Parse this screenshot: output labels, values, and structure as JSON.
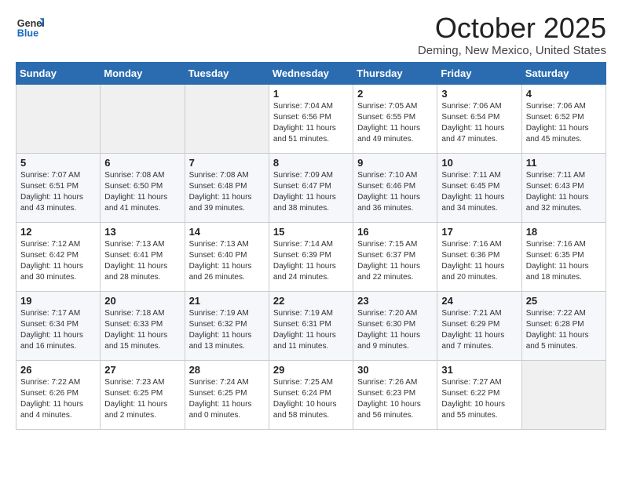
{
  "logo": {
    "general": "General",
    "blue": "Blue"
  },
  "header": {
    "month": "October 2025",
    "location": "Deming, New Mexico, United States"
  },
  "weekdays": [
    "Sunday",
    "Monday",
    "Tuesday",
    "Wednesday",
    "Thursday",
    "Friday",
    "Saturday"
  ],
  "weeks": [
    [
      {
        "day": "",
        "info": ""
      },
      {
        "day": "",
        "info": ""
      },
      {
        "day": "",
        "info": ""
      },
      {
        "day": "1",
        "info": "Sunrise: 7:04 AM\nSunset: 6:56 PM\nDaylight: 11 hours\nand 51 minutes."
      },
      {
        "day": "2",
        "info": "Sunrise: 7:05 AM\nSunset: 6:55 PM\nDaylight: 11 hours\nand 49 minutes."
      },
      {
        "day": "3",
        "info": "Sunrise: 7:06 AM\nSunset: 6:54 PM\nDaylight: 11 hours\nand 47 minutes."
      },
      {
        "day": "4",
        "info": "Sunrise: 7:06 AM\nSunset: 6:52 PM\nDaylight: 11 hours\nand 45 minutes."
      }
    ],
    [
      {
        "day": "5",
        "info": "Sunrise: 7:07 AM\nSunset: 6:51 PM\nDaylight: 11 hours\nand 43 minutes."
      },
      {
        "day": "6",
        "info": "Sunrise: 7:08 AM\nSunset: 6:50 PM\nDaylight: 11 hours\nand 41 minutes."
      },
      {
        "day": "7",
        "info": "Sunrise: 7:08 AM\nSunset: 6:48 PM\nDaylight: 11 hours\nand 39 minutes."
      },
      {
        "day": "8",
        "info": "Sunrise: 7:09 AM\nSunset: 6:47 PM\nDaylight: 11 hours\nand 38 minutes."
      },
      {
        "day": "9",
        "info": "Sunrise: 7:10 AM\nSunset: 6:46 PM\nDaylight: 11 hours\nand 36 minutes."
      },
      {
        "day": "10",
        "info": "Sunrise: 7:11 AM\nSunset: 6:45 PM\nDaylight: 11 hours\nand 34 minutes."
      },
      {
        "day": "11",
        "info": "Sunrise: 7:11 AM\nSunset: 6:43 PM\nDaylight: 11 hours\nand 32 minutes."
      }
    ],
    [
      {
        "day": "12",
        "info": "Sunrise: 7:12 AM\nSunset: 6:42 PM\nDaylight: 11 hours\nand 30 minutes."
      },
      {
        "day": "13",
        "info": "Sunrise: 7:13 AM\nSunset: 6:41 PM\nDaylight: 11 hours\nand 28 minutes."
      },
      {
        "day": "14",
        "info": "Sunrise: 7:13 AM\nSunset: 6:40 PM\nDaylight: 11 hours\nand 26 minutes."
      },
      {
        "day": "15",
        "info": "Sunrise: 7:14 AM\nSunset: 6:39 PM\nDaylight: 11 hours\nand 24 minutes."
      },
      {
        "day": "16",
        "info": "Sunrise: 7:15 AM\nSunset: 6:37 PM\nDaylight: 11 hours\nand 22 minutes."
      },
      {
        "day": "17",
        "info": "Sunrise: 7:16 AM\nSunset: 6:36 PM\nDaylight: 11 hours\nand 20 minutes."
      },
      {
        "day": "18",
        "info": "Sunrise: 7:16 AM\nSunset: 6:35 PM\nDaylight: 11 hours\nand 18 minutes."
      }
    ],
    [
      {
        "day": "19",
        "info": "Sunrise: 7:17 AM\nSunset: 6:34 PM\nDaylight: 11 hours\nand 16 minutes."
      },
      {
        "day": "20",
        "info": "Sunrise: 7:18 AM\nSunset: 6:33 PM\nDaylight: 11 hours\nand 15 minutes."
      },
      {
        "day": "21",
        "info": "Sunrise: 7:19 AM\nSunset: 6:32 PM\nDaylight: 11 hours\nand 13 minutes."
      },
      {
        "day": "22",
        "info": "Sunrise: 7:19 AM\nSunset: 6:31 PM\nDaylight: 11 hours\nand 11 minutes."
      },
      {
        "day": "23",
        "info": "Sunrise: 7:20 AM\nSunset: 6:30 PM\nDaylight: 11 hours\nand 9 minutes."
      },
      {
        "day": "24",
        "info": "Sunrise: 7:21 AM\nSunset: 6:29 PM\nDaylight: 11 hours\nand 7 minutes."
      },
      {
        "day": "25",
        "info": "Sunrise: 7:22 AM\nSunset: 6:28 PM\nDaylight: 11 hours\nand 5 minutes."
      }
    ],
    [
      {
        "day": "26",
        "info": "Sunrise: 7:22 AM\nSunset: 6:26 PM\nDaylight: 11 hours\nand 4 minutes."
      },
      {
        "day": "27",
        "info": "Sunrise: 7:23 AM\nSunset: 6:25 PM\nDaylight: 11 hours\nand 2 minutes."
      },
      {
        "day": "28",
        "info": "Sunrise: 7:24 AM\nSunset: 6:25 PM\nDaylight: 11 hours\nand 0 minutes."
      },
      {
        "day": "29",
        "info": "Sunrise: 7:25 AM\nSunset: 6:24 PM\nDaylight: 10 hours\nand 58 minutes."
      },
      {
        "day": "30",
        "info": "Sunrise: 7:26 AM\nSunset: 6:23 PM\nDaylight: 10 hours\nand 56 minutes."
      },
      {
        "day": "31",
        "info": "Sunrise: 7:27 AM\nSunset: 6:22 PM\nDaylight: 10 hours\nand 55 minutes."
      },
      {
        "day": "",
        "info": ""
      }
    ]
  ]
}
